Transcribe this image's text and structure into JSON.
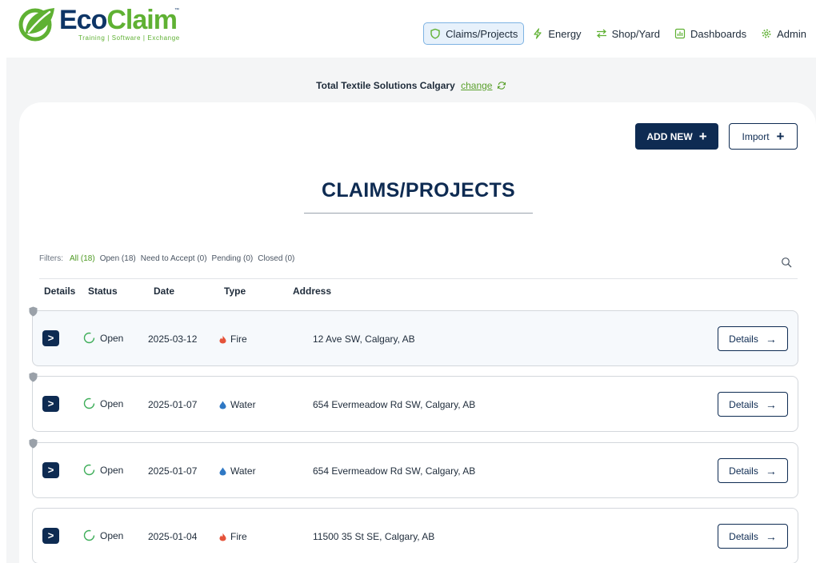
{
  "brand": {
    "name_part1": "Eco",
    "name_part2": "Claim",
    "tm": "™",
    "tagline": "Training | Software | Exchange",
    "colors": {
      "navy": "#0e3566",
      "green": "#5fb133"
    }
  },
  "nav": {
    "items": [
      {
        "label": "Claims/Projects",
        "icon": "shield-icon",
        "active": true
      },
      {
        "label": "Energy",
        "icon": "bolt-icon",
        "active": false
      },
      {
        "label": "Shop/Yard",
        "icon": "swap-arrows-icon",
        "active": false
      },
      {
        "label": "Dashboards",
        "icon": "dashboard-icon",
        "active": false
      },
      {
        "label": "Admin",
        "icon": "gear-icon",
        "active": false
      }
    ]
  },
  "company": {
    "name": "Total Textile Solutions Calgary",
    "change_label": "change",
    "refresh_icon": "refresh-icon"
  },
  "actions": {
    "add_new_label": "ADD NEW",
    "import_label": "Import",
    "plus_glyph": "+"
  },
  "page_title": "CLAIMS/PROJECTS",
  "filters": {
    "label": "Filters:",
    "items": [
      {
        "label": "All (18)",
        "active": true
      },
      {
        "label": "Open (18)",
        "active": false
      },
      {
        "label": "Need to Accept (0)",
        "active": false
      },
      {
        "label": "Pending (0)",
        "active": false
      },
      {
        "label": "Closed (0)",
        "active": false
      }
    ]
  },
  "table": {
    "columns": [
      "Details",
      "Status",
      "Date",
      "Type",
      "Address"
    ],
    "rows": [
      {
        "status": "Open",
        "date": "2025-03-12",
        "type": "Fire",
        "type_icon": "flame-icon",
        "address": "12 Ave SW, Calgary, AB",
        "details_label": "Details",
        "pinned": true
      },
      {
        "status": "Open",
        "date": "2025-01-07",
        "type": "Water",
        "type_icon": "water-drop-icon",
        "address": "654 Evermeadow Rd SW, Calgary, AB",
        "details_label": "Details",
        "pinned": true
      },
      {
        "status": "Open",
        "date": "2025-01-07",
        "type": "Water",
        "type_icon": "water-drop-icon",
        "address": "654 Evermeadow Rd SW, Calgary, AB",
        "details_label": "Details",
        "pinned": true
      },
      {
        "status": "Open",
        "date": "2025-01-04",
        "type": "Fire",
        "type_icon": "flame-icon",
        "address": "11500 35 St SE, Calgary, AB",
        "details_label": "Details",
        "pinned": false
      }
    ]
  },
  "colors": {
    "accent_navy": "#0e2b52",
    "filter_active": "#4d9a22",
    "fire": "#e5533a",
    "water": "#2f78c4",
    "status_open": "#3fae5a"
  }
}
